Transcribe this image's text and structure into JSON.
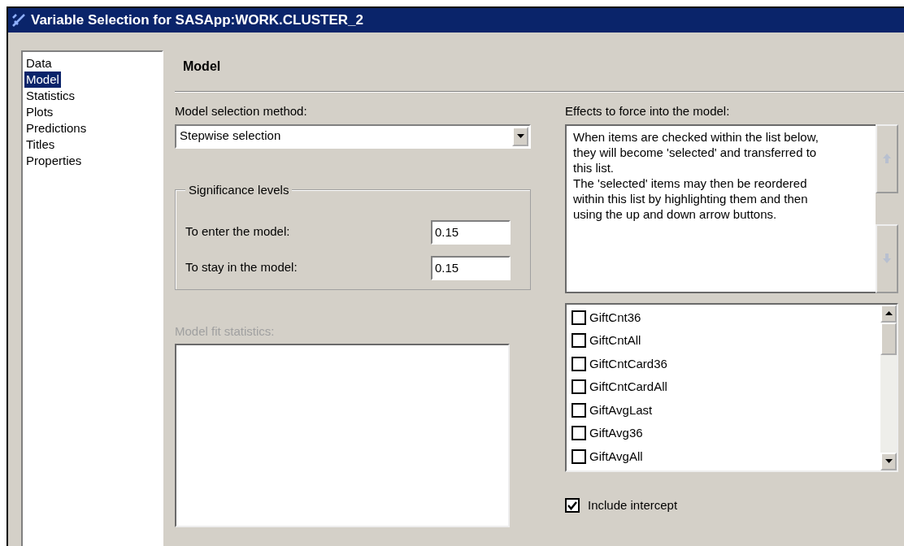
{
  "window": {
    "title": "Variable Selection for SASApp:WORK.CLUSTER_2"
  },
  "sidebar": {
    "items": [
      {
        "label": "Data",
        "selected": false
      },
      {
        "label": "Model",
        "selected": true
      },
      {
        "label": "Statistics",
        "selected": false
      },
      {
        "label": "Plots",
        "selected": false
      },
      {
        "label": "Predictions",
        "selected": false
      },
      {
        "label": "Titles",
        "selected": false
      },
      {
        "label": "Properties",
        "selected": false
      }
    ]
  },
  "page": {
    "heading": "Model"
  },
  "model_selection": {
    "label": "Model selection method:",
    "value": "Stepwise selection"
  },
  "significance": {
    "legend": "Significance levels",
    "fields": [
      {
        "label": "To enter the model:",
        "value": "0.15"
      },
      {
        "label": "To stay in the model:",
        "value": "0.15"
      }
    ]
  },
  "fit_statistics": {
    "label": "Model fit statistics:",
    "disabled": true
  },
  "effects": {
    "label": "Effects to force into the model:",
    "help": "When items are checked within the list below, they will become 'selected' and transferred to this list.\nThe 'selected' items may then be reordered within this list by highlighting them and then using the up and down arrow buttons."
  },
  "variables": [
    {
      "label": "GiftCnt36",
      "checked": false
    },
    {
      "label": "GiftCntAll",
      "checked": false
    },
    {
      "label": "GiftCntCard36",
      "checked": false
    },
    {
      "label": "GiftCntCardAll",
      "checked": false
    },
    {
      "label": "GiftAvgLast",
      "checked": false
    },
    {
      "label": "GiftAvg36",
      "checked": false
    },
    {
      "label": "GiftAvgAll",
      "checked": false
    }
  ],
  "include_intercept": {
    "label": "Include intercept",
    "checked": true
  }
}
